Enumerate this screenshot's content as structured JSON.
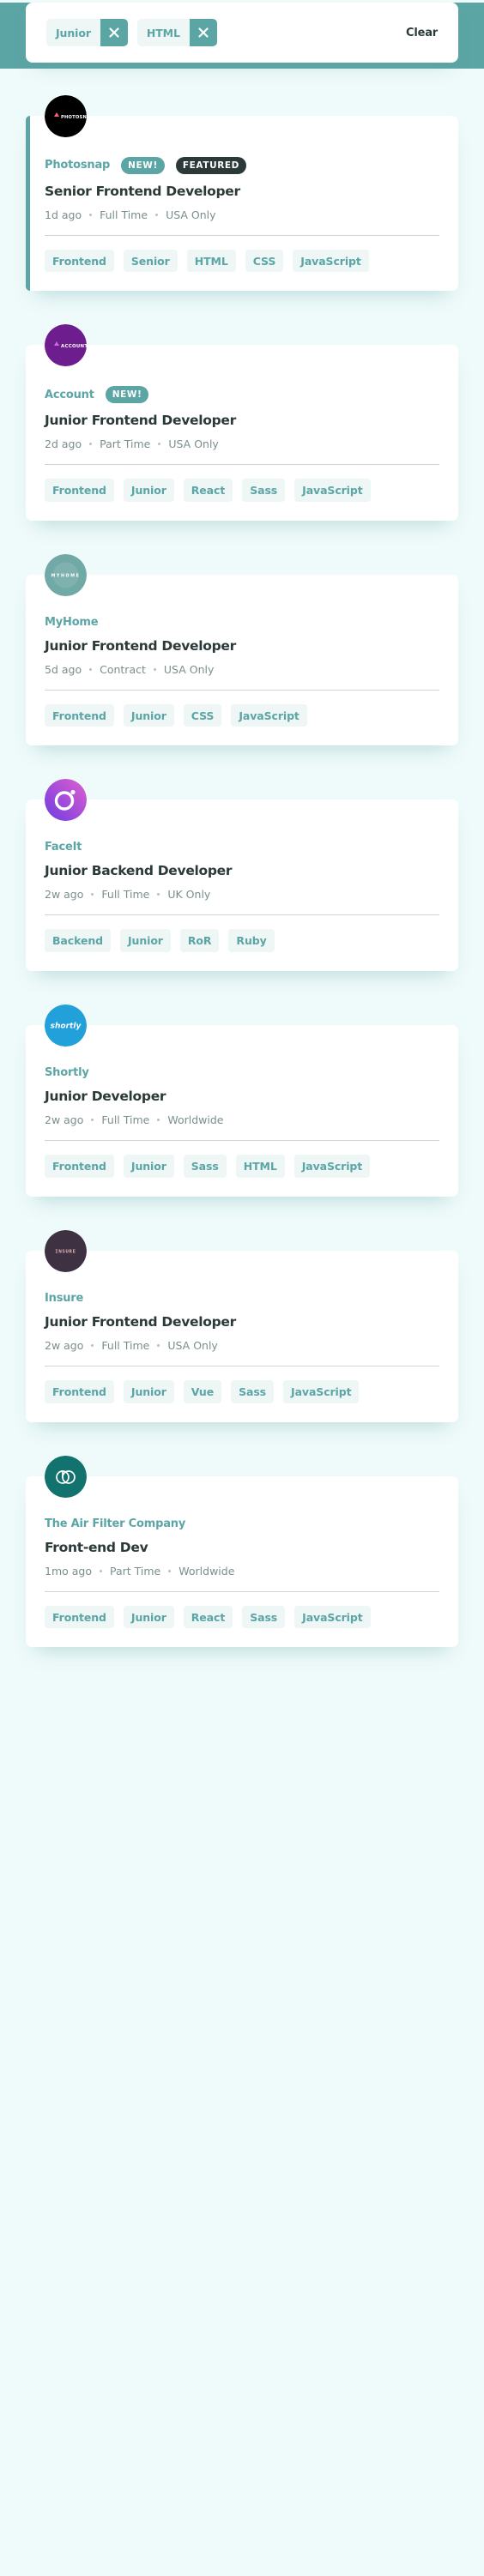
{
  "filter_bar": {
    "chips": [
      {
        "label": "Junior",
        "remove_icon": "close-icon"
      },
      {
        "label": "HTML",
        "remove_icon": "close-icon"
      }
    ],
    "clear_label": "Clear"
  },
  "colors": {
    "accent": "#5ca5a5",
    "background": "#effafa",
    "tag_background": "#eef6f6",
    "dark": "#2b3939",
    "meta_text": "#7b8e8e"
  },
  "jobs": [
    {
      "company": "Photosnap",
      "logo": {
        "name": "photosnap-logo",
        "background": "#000000",
        "text": "PHOTOSNAP"
      },
      "badges": [
        {
          "label": "NEW!",
          "type": "new"
        },
        {
          "label": "FEATURED",
          "type": "featured"
        }
      ],
      "position": "Senior Frontend Developer",
      "posted_at": "1d ago",
      "contract": "Full Time",
      "location": "USA Only",
      "featured": true,
      "tags": [
        "Frontend",
        "Senior",
        "HTML",
        "CSS",
        "JavaScript"
      ]
    },
    {
      "company": "Account",
      "logo": {
        "name": "account-logo",
        "background": "#6e1d8f",
        "text": "ACCOUNT"
      },
      "badges": [
        {
          "label": "NEW!",
          "type": "new"
        }
      ],
      "position": "Junior Frontend Developer",
      "posted_at": "2d ago",
      "contract": "Part Time",
      "location": "USA Only",
      "featured": false,
      "tags": [
        "Frontend",
        "Junior",
        "React",
        "Sass",
        "JavaScript"
      ]
    },
    {
      "company": "MyHome",
      "logo": {
        "name": "myhome-logo",
        "background": "#71a9a6",
        "text": "MYHOME"
      },
      "badges": [],
      "position": "Junior Frontend Developer",
      "posted_at": "5d ago",
      "contract": "Contract",
      "location": "USA Only",
      "featured": false,
      "tags": [
        "Frontend",
        "Junior",
        "CSS",
        "JavaScript"
      ]
    },
    {
      "company": "FaceIt",
      "logo": {
        "name": "faceit-logo",
        "background": "#8b3fd4",
        "text": ""
      },
      "badges": [],
      "position": "Junior Backend Developer",
      "posted_at": "2w ago",
      "contract": "Full Time",
      "location": "UK Only",
      "featured": false,
      "tags": [
        "Backend",
        "Junior",
        "RoR",
        "Ruby"
      ]
    },
    {
      "company": "Shortly",
      "logo": {
        "name": "shortly-logo",
        "background": "#22a0da",
        "text": "shortly"
      },
      "badges": [],
      "position": "Junior Developer",
      "posted_at": "2w ago",
      "contract": "Full Time",
      "location": "Worldwide",
      "featured": false,
      "tags": [
        "Frontend",
        "Junior",
        "Sass",
        "HTML",
        "JavaScript"
      ]
    },
    {
      "company": "Insure",
      "logo": {
        "name": "insure-logo",
        "background": "#3d3142",
        "text": "INSURE"
      },
      "badges": [],
      "position": "Junior Frontend Developer",
      "posted_at": "2w ago",
      "contract": "Full Time",
      "location": "USA Only",
      "featured": false,
      "tags": [
        "Frontend",
        "Junior",
        "Vue",
        "Sass",
        "JavaScript"
      ]
    },
    {
      "company": "The Air Filter Company",
      "logo": {
        "name": "air-filter-company-logo",
        "background": "#11726e",
        "text": ""
      },
      "badges": [],
      "position": "Front-end Dev",
      "posted_at": "1mo ago",
      "contract": "Part Time",
      "location": "Worldwide",
      "featured": false,
      "tags": [
        "Frontend",
        "Junior",
        "React",
        "Sass",
        "JavaScript"
      ]
    }
  ]
}
